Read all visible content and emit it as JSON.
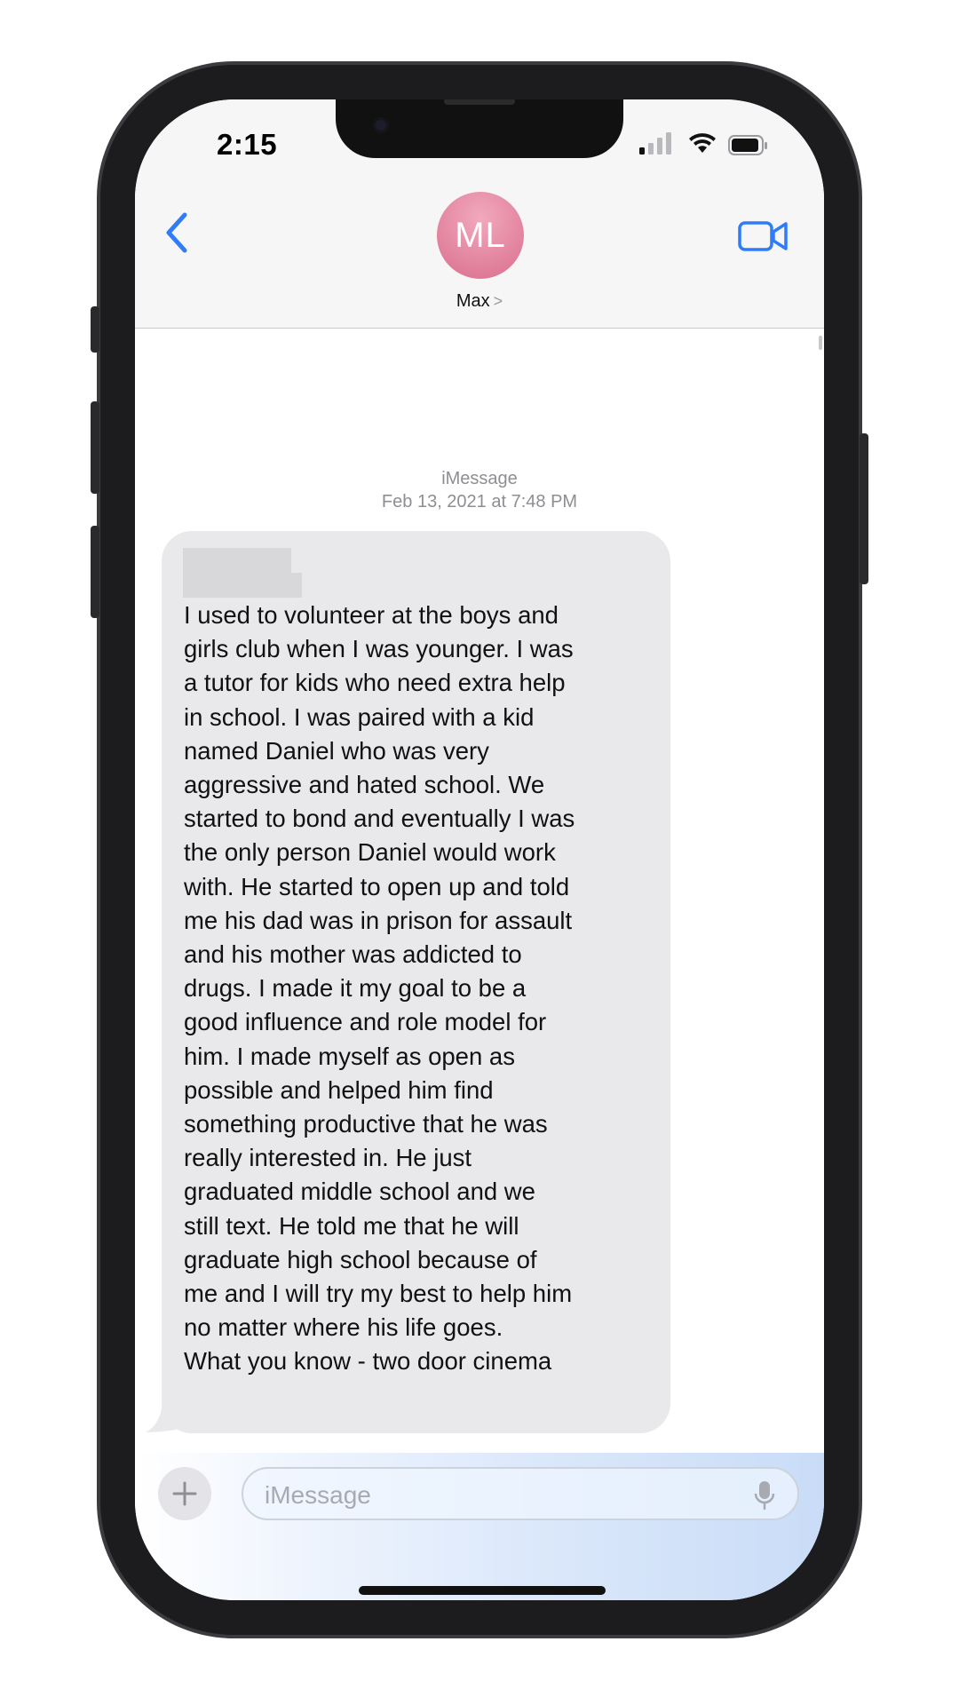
{
  "status_bar": {
    "time": "2:15"
  },
  "header": {
    "avatar_initials": "ML",
    "contact_name": "Max",
    "contact_chevron": ">"
  },
  "conversation": {
    "service": "iMessage",
    "date": "Feb 13, 2021 at 7:48 PM",
    "messages": [
      {
        "direction": "incoming",
        "text": "I used to volunteer at the boys and\ngirls club when I was younger. I was\na tutor for kids who need extra help\nin school. I was paired with a kid\nnamed Daniel who was very\naggressive and hated school. We\nstarted to bond and eventually I was\nthe only person Daniel would work\nwith. He started to open up and told\nme his dad was in prison for assault\nand his mother was addicted to\ndrugs. I made it my goal to be a\ngood influence and role model for\nhim. I made myself as open as\npossible and helped him find\nsomething productive that he was\nreally interested in. He just\ngraduated middle school and we\nstill text. He told me that he will\ngraduate high school because of\nme and I will try my best to help him\nno matter where his life goes.\nWhat you know - two door cinema"
      }
    ]
  },
  "composer": {
    "placeholder": "iMessage"
  },
  "colors": {
    "accent": "#2f7cf6",
    "incoming_bubble": "#e9e9eb",
    "avatar": "#e385a0"
  }
}
